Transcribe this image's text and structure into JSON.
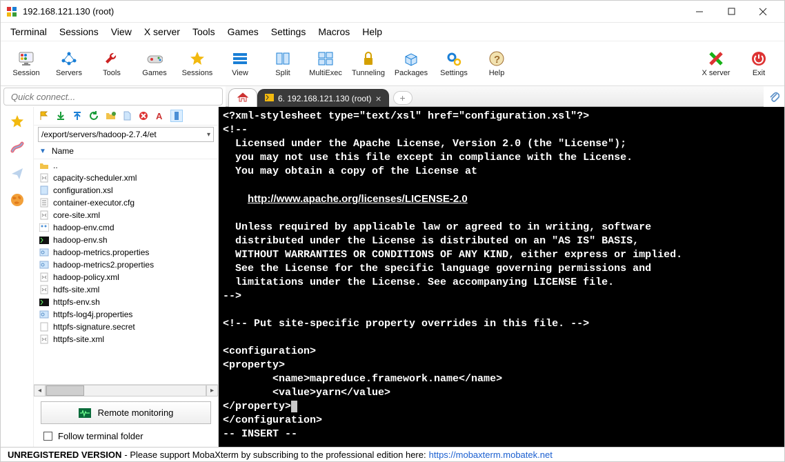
{
  "window": {
    "title": "192.168.121.130 (root)"
  },
  "menu": {
    "items": [
      "Terminal",
      "Sessions",
      "View",
      "X server",
      "Tools",
      "Games",
      "Settings",
      "Macros",
      "Help"
    ]
  },
  "toolbar": {
    "left": [
      {
        "label": "Session",
        "icon": "monitor",
        "color": "#d33"
      },
      {
        "label": "Servers",
        "icon": "nodes",
        "color": "#1a7fd6"
      },
      {
        "label": "Tools",
        "icon": "wrench",
        "color": "#c22"
      },
      {
        "label": "Games",
        "icon": "gamepad",
        "color": "#8a49c7"
      },
      {
        "label": "Sessions",
        "icon": "star",
        "color": "#f2b90f"
      },
      {
        "label": "View",
        "icon": "list",
        "color": "#1a7fd6"
      },
      {
        "label": "Split",
        "icon": "split",
        "color": "#1a7fd6"
      },
      {
        "label": "MultiExec",
        "icon": "grid",
        "color": "#1a7fd6"
      },
      {
        "label": "Tunneling",
        "icon": "lock",
        "color": "#d4a000"
      },
      {
        "label": "Packages",
        "icon": "box",
        "color": "#1a7fd6"
      },
      {
        "label": "Settings",
        "icon": "gears",
        "color": "#1a7fd6"
      },
      {
        "label": "Help",
        "icon": "question",
        "color": "#9c6b2e"
      }
    ],
    "right": [
      {
        "label": "X server",
        "icon": "x",
        "color": "#17b117"
      },
      {
        "label": "Exit",
        "icon": "power",
        "color": "#d33"
      }
    ]
  },
  "quick_connect_placeholder": "Quick connect...",
  "tabs": {
    "active_label": "6. 192.168.121.130 (root)"
  },
  "file_panel": {
    "path": "/export/servers/hadoop-2.7.4/et",
    "header": "Name",
    "files": [
      {
        "name": "..",
        "type": "folder-up"
      },
      {
        "name": "capacity-scheduler.xml",
        "type": "xml"
      },
      {
        "name": "configuration.xsl",
        "type": "file-blue"
      },
      {
        "name": "container-executor.cfg",
        "type": "cfg"
      },
      {
        "name": "core-site.xml",
        "type": "xml"
      },
      {
        "name": "hadoop-env.cmd",
        "type": "cmd"
      },
      {
        "name": "hadoop-env.sh",
        "type": "sh"
      },
      {
        "name": "hadoop-metrics.properties",
        "type": "props"
      },
      {
        "name": "hadoop-metrics2.properties",
        "type": "props"
      },
      {
        "name": "hadoop-policy.xml",
        "type": "xml"
      },
      {
        "name": "hdfs-site.xml",
        "type": "xml"
      },
      {
        "name": "httpfs-env.sh",
        "type": "sh"
      },
      {
        "name": "httpfs-log4j.properties",
        "type": "props"
      },
      {
        "name": "httpfs-signature.secret",
        "type": "file"
      },
      {
        "name": "httpfs-site.xml",
        "type": "xml"
      }
    ],
    "remote_button": "Remote monitoring",
    "follow_label": "Follow terminal folder"
  },
  "terminal": {
    "lines": [
      "<?xml-stylesheet type=\"text/xsl\" href=\"configuration.xsl\"?>",
      "<!--",
      "  Licensed under the Apache License, Version 2.0 (the \"License\");",
      "  you may not use this file except in compliance with the License.",
      "  You may obtain a copy of the License at",
      "",
      "    <<U>>http://www.apache.org/licenses/LICENSE-2.0<</U>>",
      "",
      "  Unless required by applicable law or agreed to in writing, software",
      "  distributed under the License is distributed on an \"AS IS\" BASIS,",
      "  WITHOUT WARRANTIES OR CONDITIONS OF ANY KIND, either express or implied.",
      "  See the License for the specific language governing permissions and",
      "  limitations under the License. See accompanying LICENSE file.",
      "-->",
      "",
      "<!-- Put site-specific property overrides in this file. -->",
      "",
      "<configuration>",
      "<property>",
      "        <name>mapreduce.framework.name</name>",
      "        <value>yarn</value>",
      "</property><<CURSOR>>",
      "</configuration>",
      "-- INSERT --"
    ]
  },
  "status": {
    "left_bold": "UNREGISTERED VERSION",
    "middle": "  -  Please support MobaXterm by subscribing to the professional edition here:  ",
    "link": "https://mobaxterm.mobatek.net"
  }
}
